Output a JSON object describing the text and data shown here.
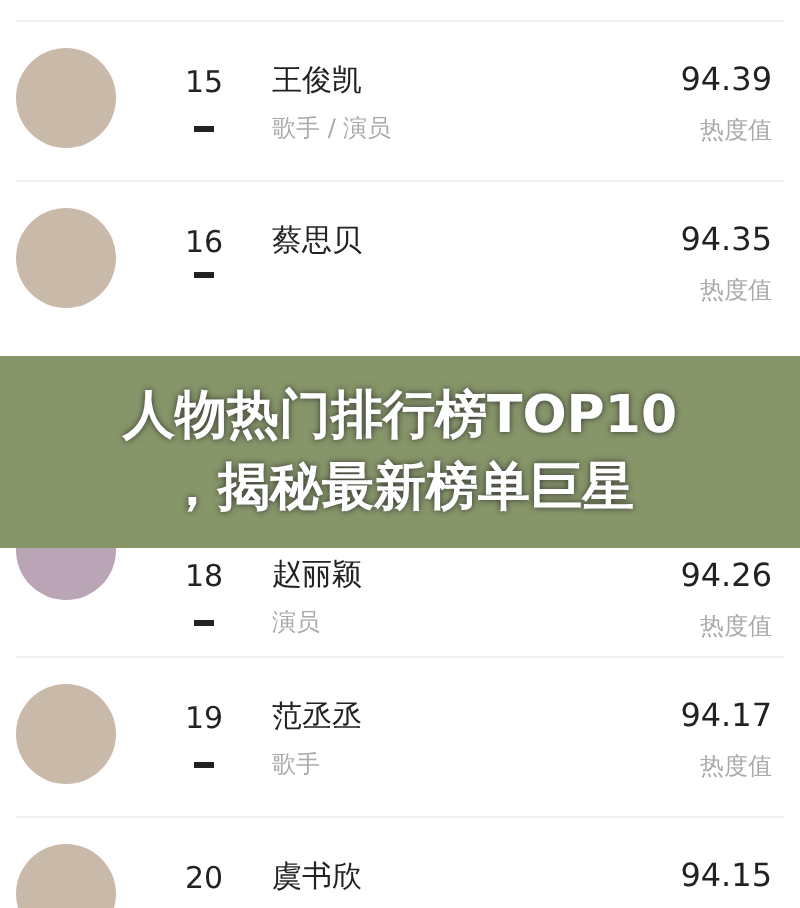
{
  "rows": [
    {
      "kind": "unchanged",
      "rank": "15",
      "name": "王俊凯",
      "role": "歌手 / 演员",
      "score": "94.39",
      "score_label": "热度值"
    },
    {
      "kind": "unchanged",
      "rank": "16",
      "name": "蔡思贝",
      "score": "94.35",
      "score_label": "热度值"
    },
    {
      "kind": "banner",
      "title_lines": [
        "人物热门排行榜TOP10",
        "，揭秘最新榜单巨星"
      ]
    },
    {
      "kind": "unchanged",
      "rank": "18",
      "name": "赵丽颖",
      "role": "演员",
      "score": "94.26",
      "score_label": "热度值",
      "partial": true
    },
    {
      "kind": "unchanged",
      "rank": "19",
      "name": "范丞丞",
      "role": "歌手",
      "score": "94.17",
      "score_label": "热度值"
    },
    {
      "rank": "20",
      "name": "虞书欣",
      "score": "94.15"
    }
  ]
}
